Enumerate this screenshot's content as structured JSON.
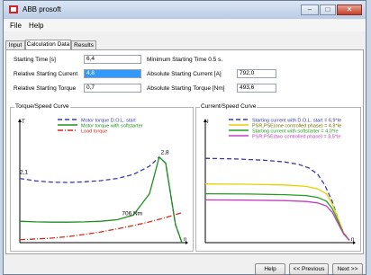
{
  "window": {
    "title": "ABB prosoft"
  },
  "menu": [
    "File",
    "Help"
  ],
  "tabs": [
    "Input",
    "Calculation Data",
    "Results"
  ],
  "fields": {
    "starting_time_label": "Starting Time [s]",
    "starting_time_value": "6,4",
    "rel_current_label": "Relative Starting Current",
    "rel_current_value": "4,8",
    "rel_torque_label": "Relative Starting Torque",
    "rel_torque_value": "0,7",
    "min_start_time_label": "Minimum Starting Time 0.5 s.",
    "abs_current_label": "Absolute Starting Current [A]",
    "abs_current_value": "792,0",
    "abs_torque_label": "Absolute Starting Torque [Nm]",
    "abs_torque_value": "493,6"
  },
  "torque_chart_group": "Torque/Speed Curve",
  "current_chart_group": "Current/Speed Curve",
  "buttons": {
    "help": "Help",
    "previous": "<< Previous",
    "next": "Next >>"
  },
  "chart_data": [
    {
      "type": "line",
      "title": "Torque/Speed Curve",
      "xlabel": "n",
      "ylabel": "T",
      "xlim": [
        0,
        1
      ],
      "ylim": [
        0,
        3
      ],
      "legend_position": "top",
      "annotations": [
        "2,1",
        "2,8",
        "706 Nm"
      ],
      "series": [
        {
          "name": "Motor torque D.O.L. start",
          "color": "#3a3aa8",
          "style": "dashed",
          "x": [
            0,
            0.1,
            0.2,
            0.3,
            0.4,
            0.5,
            0.6,
            0.7,
            0.8,
            0.86,
            0.9,
            0.93,
            0.96,
            1.0
          ],
          "y": [
            2.1,
            2.02,
            1.98,
            1.97,
            1.99,
            2.03,
            2.1,
            2.23,
            2.5,
            2.8,
            2.6,
            1.6,
            0.6,
            0
          ]
        },
        {
          "name": "Motor torque with softstarter",
          "color": "#1f8f1f",
          "style": "solid",
          "x": [
            0,
            0.1,
            0.2,
            0.3,
            0.4,
            0.5,
            0.6,
            0.7,
            0.8,
            0.86,
            0.9,
            0.93,
            0.96,
            1.0
          ],
          "y": [
            0.7,
            0.68,
            0.67,
            0.67,
            0.68,
            0.7,
            0.75,
            0.9,
            1.6,
            2.8,
            2.6,
            1.6,
            0.6,
            0
          ]
        },
        {
          "name": "Load torque",
          "color": "#d42a1a",
          "style": "dashdot",
          "x": [
            0,
            0.1,
            0.2,
            0.3,
            0.4,
            0.5,
            0.6,
            0.7,
            0.8,
            0.9,
            1.0
          ],
          "y": [
            0.1,
            0.12,
            0.15,
            0.2,
            0.27,
            0.35,
            0.45,
            0.56,
            0.68,
            0.82,
            0.98
          ]
        }
      ]
    },
    {
      "type": "line",
      "title": "Current/Speed Curve",
      "xlabel": "n",
      "ylabel": "I",
      "xlim": [
        0,
        1
      ],
      "ylim": [
        0,
        7.5
      ],
      "legend_position": "top",
      "series": [
        {
          "name": "Starting current with D.O.L. start = 6,9*Ie",
          "color": "#3a3aa8",
          "style": "dashed",
          "x": [
            0,
            0.2,
            0.4,
            0.55,
            0.65,
            0.72,
            0.78,
            0.83,
            0.88,
            0.92,
            0.96,
            1.0
          ],
          "y": [
            6.9,
            6.85,
            6.75,
            6.6,
            6.4,
            6.1,
            5.6,
            4.7,
            3.4,
            2.0,
            0.8,
            0.2
          ]
        },
        {
          "name": "PSR,PSE(one controlled phase) = 4.8*Ie",
          "color": "#e8d000",
          "style": "solid",
          "x": [
            0,
            0.3,
            0.55,
            0.7,
            0.78,
            0.84,
            0.88,
            0.92,
            0.96,
            1.0
          ],
          "y": [
            4.8,
            4.78,
            4.72,
            4.6,
            4.4,
            4.0,
            3.2,
            2.0,
            0.8,
            0.2
          ]
        },
        {
          "name": "Starting current with softstarter = 4,0*Ie",
          "color": "#1f9f1f",
          "style": "solid",
          "x": [
            0,
            0.3,
            0.55,
            0.7,
            0.78,
            0.84,
            0.88,
            0.92,
            0.96,
            1.0
          ],
          "y": [
            4.0,
            3.98,
            3.93,
            3.85,
            3.7,
            3.4,
            2.8,
            1.8,
            0.75,
            0.2
          ]
        },
        {
          "name": "PSR,PSE(two controlled phase) = 3,5*Ie",
          "color": "#c040c0",
          "style": "solid",
          "x": [
            0,
            0.3,
            0.55,
            0.7,
            0.78,
            0.84,
            0.88,
            0.92,
            0.96,
            1.0
          ],
          "y": [
            3.5,
            3.48,
            3.44,
            3.37,
            3.25,
            3.0,
            2.5,
            1.6,
            0.7,
            0.2
          ]
        }
      ]
    }
  ]
}
